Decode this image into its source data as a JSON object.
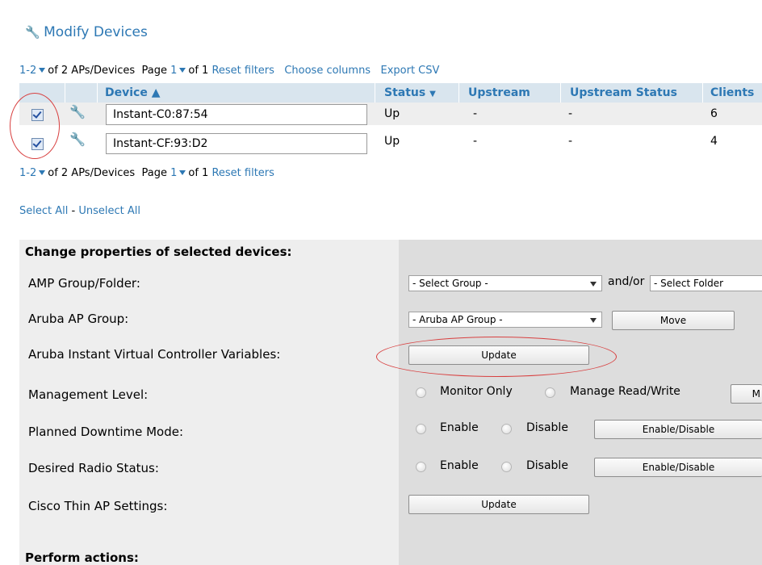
{
  "title": "Modify Devices",
  "pager_top": {
    "range": "1-2",
    "of_text": "of 2 APs/Devices",
    "page_label": "Page",
    "page": "1",
    "of_pages": "of 1",
    "reset": "Reset filters",
    "choose_columns": "Choose columns",
    "export": "Export CSV"
  },
  "table": {
    "headers": [
      "Device ▲",
      "Status",
      "Upstream",
      "Upstream Status",
      "Clients"
    ],
    "rows": [
      {
        "device": "Instant-C0:87:54",
        "status": "Up",
        "upstream": "-",
        "upstream_status": "-",
        "clients": "6"
      },
      {
        "device": "Instant-CF:93:D2",
        "status": "Up",
        "upstream": "-",
        "upstream_status": "-",
        "clients": "4"
      }
    ]
  },
  "pager_bottom": {
    "range": "1-2",
    "of_text": "of 2 APs/Devices",
    "page_label": "Page",
    "page": "1",
    "of_pages": "of 1",
    "reset": "Reset filters"
  },
  "selection": {
    "select_all": "Select All",
    "separator": " - ",
    "unselect_all": "Unselect All"
  },
  "props": {
    "heading": "Change properties of selected devices:",
    "amp_group_label": "AMP Group/Folder:",
    "group_select": "- Select Group -",
    "andor": "and/or",
    "folder_select": "- Select Folder",
    "aruba_group_label": "Aruba AP Group:",
    "aruba_select": "- Aruba AP Group -",
    "move": "Move",
    "iap_label": "Aruba Instant Virtual Controller Variables:",
    "update": "Update",
    "mgmt_label": "Management Level:",
    "monitor_only": "Monitor Only",
    "manage_rw": "Manage Read/Write",
    "mgmt_btn": "M",
    "downtime_label": "Planned Downtime Mode:",
    "enable": "Enable",
    "disable": "Disable",
    "enable_disable": "Enable/Disable",
    "radio_label": "Desired Radio Status:",
    "cisco_label": "Cisco Thin AP Settings:",
    "cisco_update": "Update"
  },
  "actions_heading": "Perform actions:"
}
